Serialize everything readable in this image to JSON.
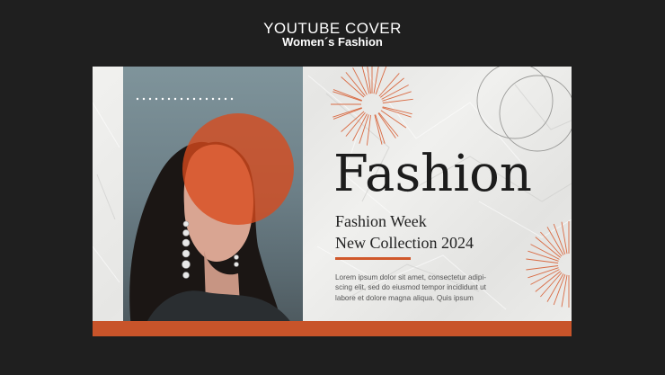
{
  "header": {
    "title": "YOUTUBE COVER",
    "subtitle": "Women´s Fashion"
  },
  "cover": {
    "headline": "Fashion",
    "subheading_line1": "Fashion Week",
    "subheading_line2": "New Collection 2024",
    "body": "Lorem ipsum dolor sit amet, consectetur adipi-scing elit, sed do eiusmod tempor incididunt ut labore et dolore magna aliqua. Quis ipsum"
  },
  "colors": {
    "background": "#1f1f1f",
    "paper": "#efefed",
    "accent": "#c8542a",
    "text": "#1c1c1c"
  },
  "icons": [
    "sunburst-ornament",
    "overlapping-circles-ornament",
    "dotted-line-ornament",
    "orange-circle-overlay"
  ]
}
